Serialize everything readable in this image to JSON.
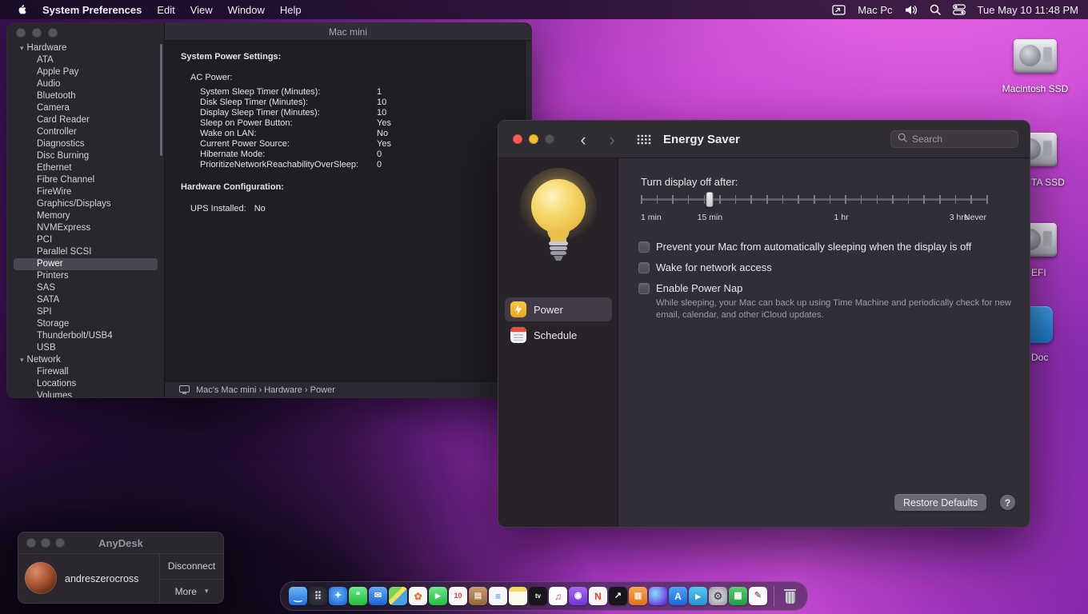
{
  "menu_bar": {
    "app_name": "System Preferences",
    "menus": [
      "Edit",
      "View",
      "Window",
      "Help"
    ],
    "status_device": "Mac Pc",
    "clock": "Tue May 10 11:48 PM"
  },
  "system_info_window": {
    "title": "Mac mini",
    "sidebar_sections": [
      {
        "label": "Hardware",
        "selected_item": "Power",
        "items": [
          "ATA",
          "Apple Pay",
          "Audio",
          "Bluetooth",
          "Camera",
          "Card Reader",
          "Controller",
          "Diagnostics",
          "Disc Burning",
          "Ethernet",
          "Fibre Channel",
          "FireWire",
          "Graphics/Displays",
          "Memory",
          "NVMExpress",
          "PCI",
          "Parallel SCSI",
          "Power",
          "Printers",
          "SAS",
          "SATA",
          "SPI",
          "Storage",
          "Thunderbolt/USB4",
          "USB"
        ]
      },
      {
        "label": "Network",
        "selected_item": "",
        "items": [
          "Firewall",
          "Locations",
          "Volumes"
        ]
      }
    ],
    "content": {
      "section_heading": "System Power Settings:",
      "group_heading": "AC Power:",
      "settings": [
        {
          "label": "System Sleep Timer (Minutes):",
          "value": "1"
        },
        {
          "label": "Disk Sleep Timer (Minutes):",
          "value": "10"
        },
        {
          "label": "Display Sleep Timer (Minutes):",
          "value": "10"
        },
        {
          "label": "Sleep on Power Button:",
          "value": "Yes"
        },
        {
          "label": "Wake on LAN:",
          "value": "No"
        },
        {
          "label": "Current Power Source:",
          "value": "Yes"
        },
        {
          "label": "Hibernate Mode:",
          "value": "0"
        },
        {
          "label": "PrioritizeNetworkReachabilityOverSleep:",
          "value": "0"
        }
      ],
      "hardware_heading": "Hardware Configuration:",
      "ups_label": "UPS Installed:",
      "ups_value": "No"
    },
    "status_breadcrumb": "Mac's Mac mini › Hardware › Power"
  },
  "energy_saver_window": {
    "title": "Energy Saver",
    "search_placeholder": "Search",
    "sidebar_items": [
      {
        "label": "Power",
        "icon": "power-bolt",
        "selected": true
      },
      {
        "label": "Schedule",
        "icon": "calendar",
        "selected": false
      }
    ],
    "slider": {
      "label": "Turn display off after:",
      "tick_labels": [
        {
          "text": "1 min",
          "percent": 0
        },
        {
          "text": "15 min",
          "percent": 20
        },
        {
          "text": "1 hr",
          "percent": 58
        },
        {
          "text": "3 hrs",
          "percent": 92
        },
        {
          "text": "Never",
          "percent": 100
        }
      ],
      "thumb_percent": 20
    },
    "checkboxes": [
      {
        "label": "Prevent your Mac from automatically sleeping when the display is off",
        "checked": false
      },
      {
        "label": "Wake for network access",
        "checked": false
      },
      {
        "label": "Enable Power Nap",
        "checked": false
      }
    ],
    "power_nap_note": "While sleeping, your Mac can back up using Time Machine and periodically check for new email, calendar, and other iCloud updates.",
    "restore_defaults": "Restore Defaults",
    "help_button": "?"
  },
  "anydesk_window": {
    "title": "AnyDesk",
    "username": "andreszerocross",
    "disconnect_button": "Disconnect",
    "more_button": "More"
  },
  "desktop_icons": [
    {
      "label": "Macintosh SSD",
      "kind": "drive"
    },
    {
      "label": "TA SSD",
      "kind": "drive"
    },
    {
      "label": "EFI",
      "kind": "drive"
    },
    {
      "label": "Doc",
      "kind": "document"
    }
  ],
  "dock_apps": [
    {
      "name": "finder",
      "glyph": "‿",
      "fg": "#ffffff",
      "bg": "linear-gradient(180deg,#6ab6f5,#1e6fe0)",
      "fs": 12
    },
    {
      "name": "launchpad",
      "glyph": "⠿",
      "fg": "#d8d8de",
      "bg": "radial-gradient(circle,#3c3c44,#222228)",
      "fs": 13
    },
    {
      "name": "safari",
      "glyph": "✦",
      "fg": "#ffffff",
      "bg": "radial-gradient(circle at 50% 40%,#5fb2f2,#1460d8)",
      "fs": 11
    },
    {
      "name": "messages",
      "glyph": "❝",
      "fg": "#ffffff",
      "bg": "linear-gradient(180deg,#6de78a,#23bf3f)",
      "fs": 10
    },
    {
      "name": "mail",
      "glyph": "✉",
      "fg": "#ffffff",
      "bg": "linear-gradient(180deg,#64aaf6,#1c62d8)",
      "fs": 11
    },
    {
      "name": "maps",
      "glyph": "",
      "fg": "#ffffff",
      "bg": "linear-gradient(135deg,#79d35c 0%,#79d35c 38%,#f2e05a 38%,#f2e05a 55%,#44a3e4 55%)",
      "fs": 11
    },
    {
      "name": "photos",
      "glyph": "✿",
      "fg": "#e8742e",
      "bg": "#f6f6f8",
      "fs": 12
    },
    {
      "name": "facetime",
      "glyph": "▶",
      "fg": "#ffffff",
      "bg": "linear-gradient(180deg,#6de78a,#23bf3f)",
      "fs": 9
    },
    {
      "name": "calendar",
      "glyph": "10",
      "fg": "#ec3e30",
      "bg": "#f6f6f8",
      "fs": 9
    },
    {
      "name": "contacts",
      "glyph": "▤",
      "fg": "#f2e8d8",
      "bg": "linear-gradient(180deg,#c79a6b,#96653a)",
      "fs": 10
    },
    {
      "name": "reminders",
      "glyph": "≡",
      "fg": "#3a86f0",
      "bg": "#f6f6f8",
      "fs": 12
    },
    {
      "name": "notes",
      "glyph": "",
      "fg": "#000000",
      "bg": "linear-gradient(180deg,#f2d868 0%,#f2d868 27%,#fbf8ec 27%)",
      "fs": 10
    },
    {
      "name": "tv",
      "glyph": "tv",
      "fg": "#ffffff",
      "bg": "#17171b",
      "fs": 8
    },
    {
      "name": "music",
      "glyph": "♫",
      "fg": "#ec4458",
      "bg": "#fcfcfe",
      "fs": 12
    },
    {
      "name": "podcasts",
      "glyph": "◉",
      "fg": "#ffffff",
      "bg": "linear-gradient(180deg,#a868f2,#6c38d8)",
      "fs": 11
    },
    {
      "name": "news",
      "glyph": "N",
      "fg": "#ec3e30",
      "bg": "#f6f6f8",
      "fs": 12
    },
    {
      "name": "stocks",
      "glyph": "↗",
      "fg": "#ffffff",
      "bg": "#17171b",
      "fs": 11
    },
    {
      "name": "books",
      "glyph": "▥",
      "fg": "#ffffff",
      "bg": "linear-gradient(180deg,#f7a74e,#e2711c)",
      "fs": 10
    },
    {
      "name": "siri",
      "glyph": "",
      "fg": "#ffffff",
      "bg": "radial-gradient(circle at 35% 35%,#8ae0f8 0%,#6a4ae8 70%,#3a2a98 100%)",
      "fs": 10
    },
    {
      "name": "app-store",
      "glyph": "A",
      "fg": "#ffffff",
      "bg": "linear-gradient(180deg,#4ea5f5,#1b66dd)",
      "fs": 12
    },
    {
      "name": "telegram",
      "glyph": "▸",
      "fg": "#ffffff",
      "bg": "linear-gradient(180deg,#54c8f0,#2592d2)",
      "fs": 13
    },
    {
      "name": "system-preferences",
      "glyph": "⚙",
      "fg": "#4a4a52",
      "bg": "radial-gradient(circle,#e4e4e8,#94949c)",
      "fs": 13
    },
    {
      "name": "numbers",
      "glyph": "▦",
      "fg": "#ffffff",
      "bg": "linear-gradient(180deg,#57d06e,#1f9f44)",
      "fs": 11
    },
    {
      "name": "textedit",
      "glyph": "✎",
      "fg": "#8a8a92",
      "bg": "#fafafc",
      "fs": 11
    }
  ]
}
